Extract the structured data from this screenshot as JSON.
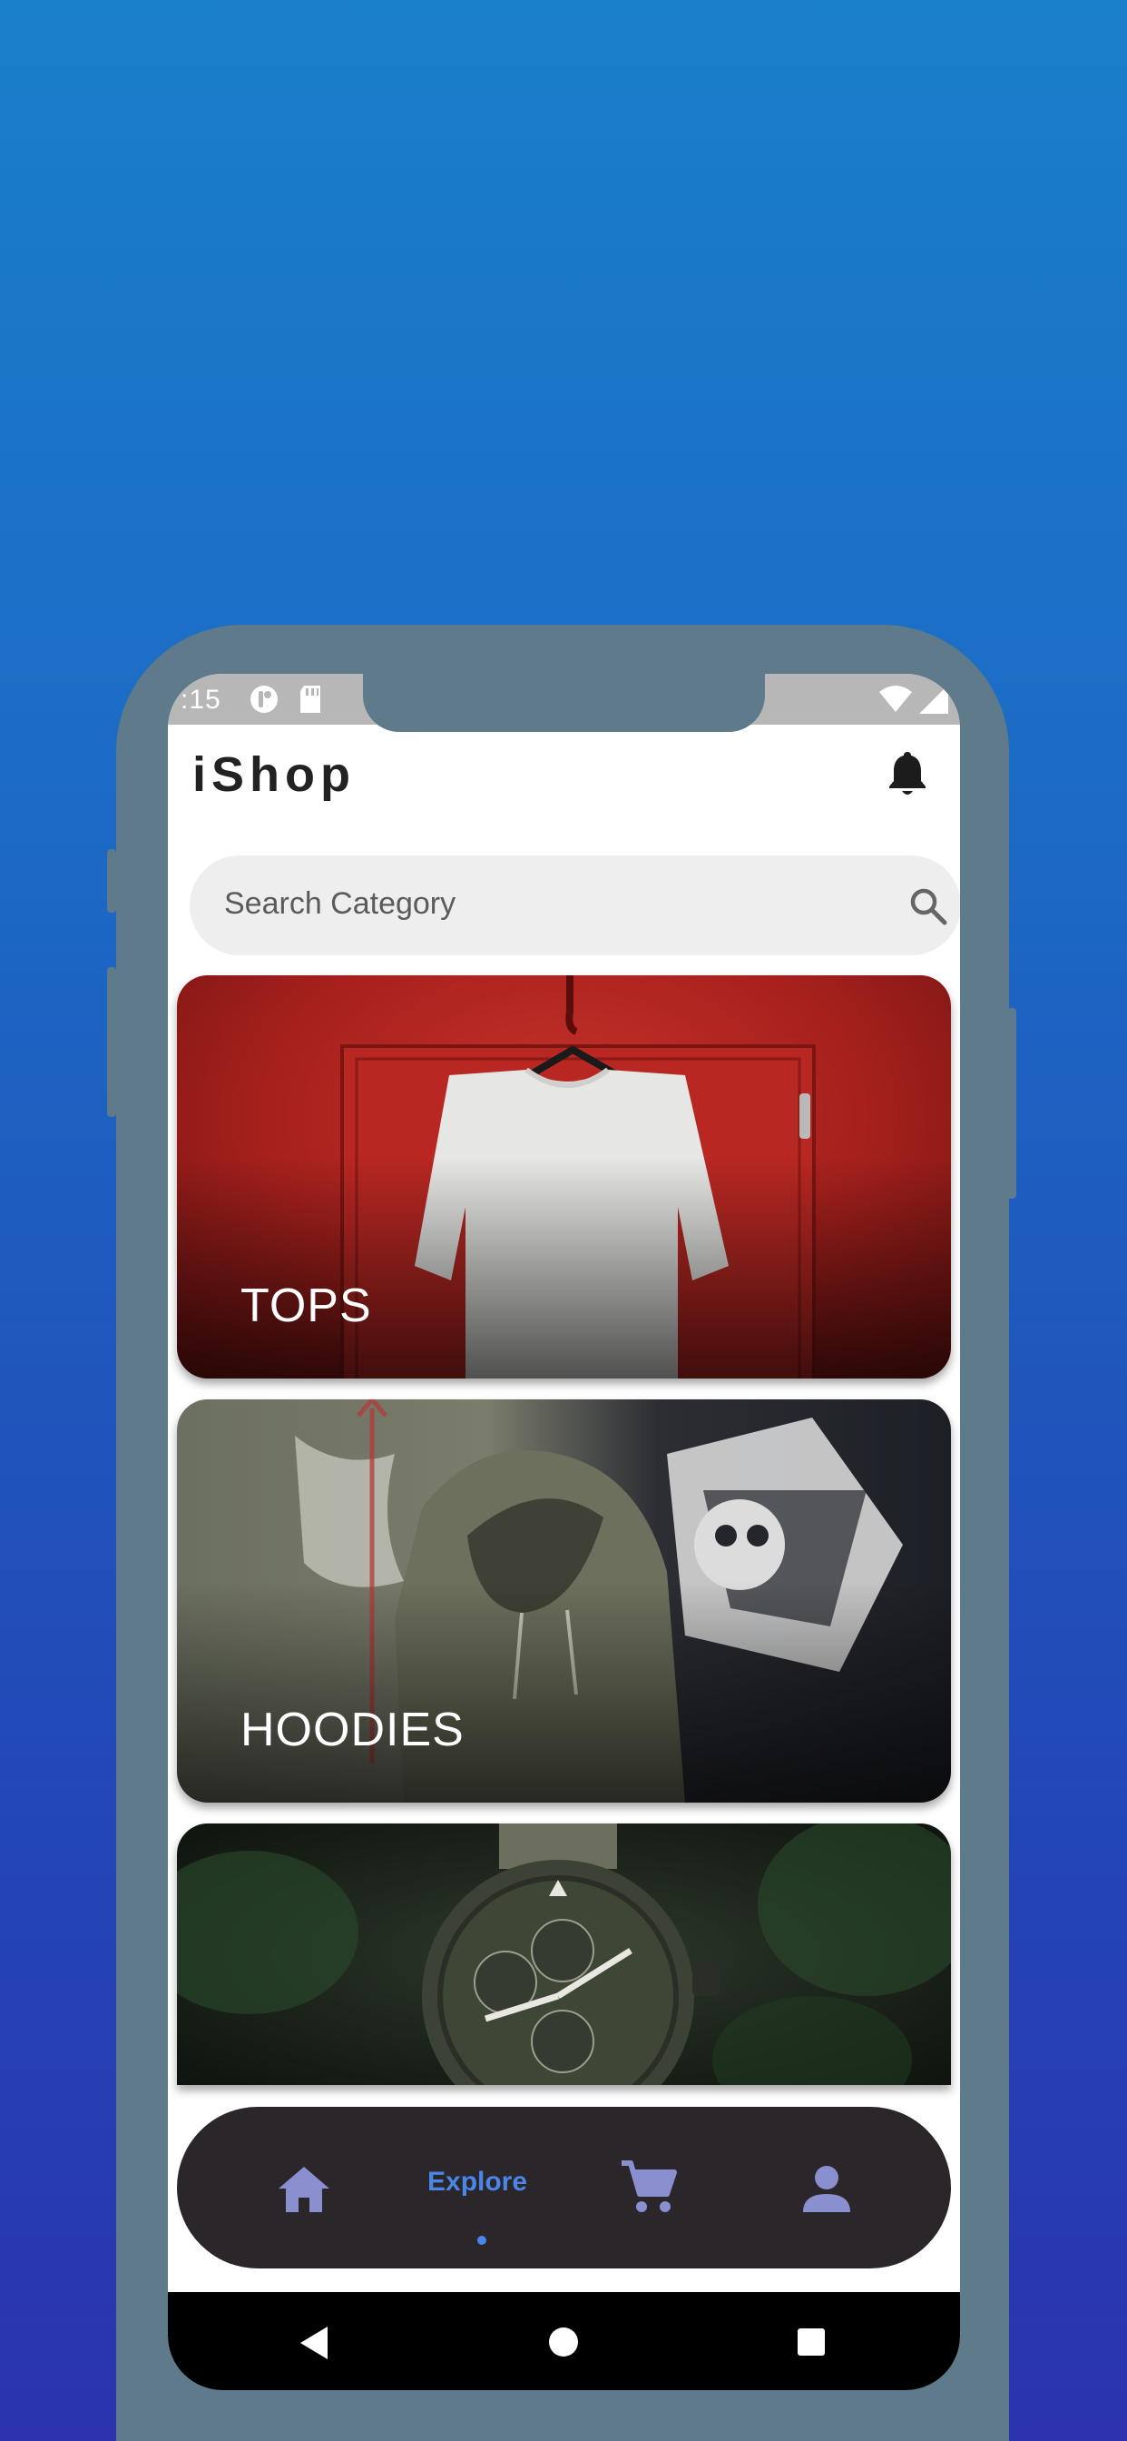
{
  "status_bar": {
    "time": ":15",
    "icons": [
      "notification-icon",
      "sd-card-icon",
      "wifi-icon",
      "signal-icon"
    ]
  },
  "header": {
    "title": "iShop",
    "bell_icon": "bell-icon"
  },
  "search": {
    "placeholder": "Search Category",
    "icon": "search-icon"
  },
  "categories": [
    {
      "label": "TOPS"
    },
    {
      "label": "HOODIES"
    },
    {
      "label": ""
    }
  ],
  "bottom_nav": {
    "items": [
      {
        "icon": "home-icon",
        "label": ""
      },
      {
        "icon": "",
        "label": "Explore",
        "active": true
      },
      {
        "icon": "cart-icon",
        "label": ""
      },
      {
        "icon": "person-icon",
        "label": ""
      }
    ]
  },
  "colors": {
    "accent": "#4a86e8",
    "nav_icon": "#8a8fd0",
    "nav_bg": "#2a2629"
  }
}
